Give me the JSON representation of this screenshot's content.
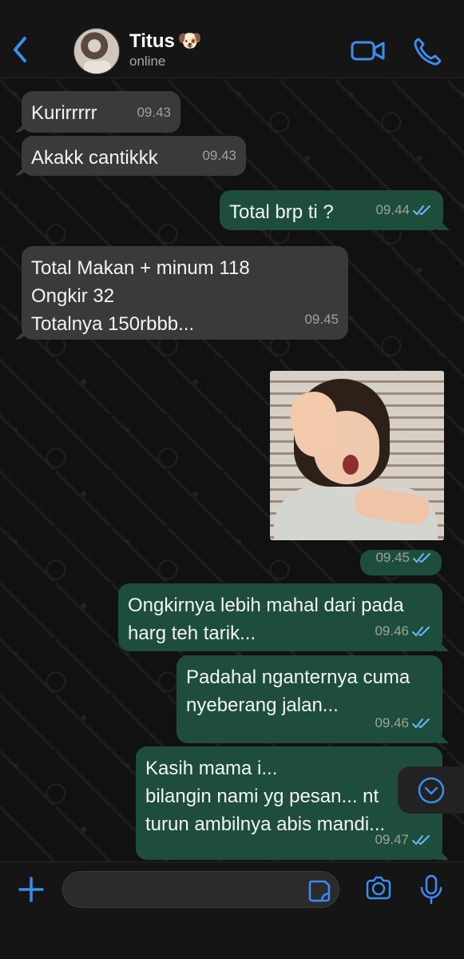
{
  "contact": {
    "name": "Titus",
    "emoji": "🐶",
    "status": "online"
  },
  "icons": {
    "back": "back-icon",
    "video": "video-call-icon",
    "phone": "voice-call-icon",
    "scroll": "chevron-down-icon",
    "add": "plus-icon",
    "sticker": "sticker-icon",
    "camera": "camera-icon",
    "mic": "microphone-icon"
  },
  "colors": {
    "accent": "#4ea3ff",
    "incoming_bubble": "#3a3a3a",
    "outgoing_bubble": "#1f4d3c",
    "read_check": "#6bb6ff"
  },
  "messages": [
    {
      "text": "Kurirrrrr",
      "time": "09.43",
      "direction": "in"
    },
    {
      "text": "Akakk cantikkk",
      "time": "09.43",
      "direction": "in"
    },
    {
      "text": "Total brp ti ?",
      "time": "09.44",
      "direction": "out"
    },
    {
      "text": "Total Makan + minum  118\nOngkir 32\nTotalnya 150rbbb...",
      "time": "09.45",
      "direction": "in"
    },
    {
      "time": "09.45",
      "direction": "out",
      "type": "photo"
    },
    {
      "text": "Ongkirnya lebih mahal dari pada\nharg teh tarik...",
      "time": "09.46",
      "direction": "out"
    },
    {
      "text": "Padahal nganternya cuma\nnyeberang jalan...",
      "time": "09.46",
      "direction": "out"
    },
    {
      "text": "Kasih mama i...\nbilangin nami yg pesan... nt\nturun ambilnya abis mandi...",
      "time": "09.47",
      "direction": "out"
    }
  ],
  "composer": {
    "value": "",
    "placeholder": ""
  }
}
